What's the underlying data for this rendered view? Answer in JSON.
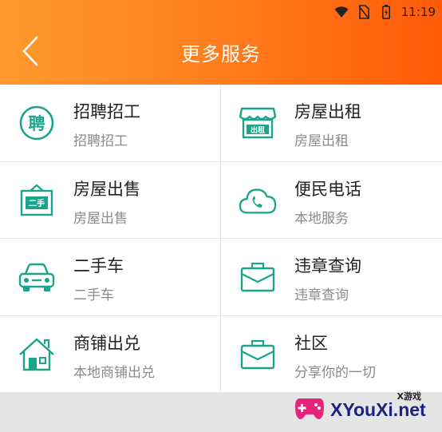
{
  "status_bar": {
    "time": "11:19"
  },
  "header": {
    "title": "更多服务"
  },
  "services": [
    {
      "title": "招聘招工",
      "subtitle": "招聘招工",
      "icon_text": "聘"
    },
    {
      "title": "房屋出租",
      "subtitle": "房屋出租",
      "icon_text": "出租"
    },
    {
      "title": "房屋出售",
      "subtitle": "房屋出售",
      "icon_text": "二手"
    },
    {
      "title": "便民电话",
      "subtitle": "本地服务"
    },
    {
      "title": "二手车",
      "subtitle": "二手车"
    },
    {
      "title": "违章查询",
      "subtitle": "违章查询"
    },
    {
      "title": "商铺出兑",
      "subtitle": "本地商铺出兑"
    },
    {
      "title": "社区",
      "subtitle": "分享你的一切"
    }
  ],
  "watermark": {
    "brand": "XYouXi.net",
    "tag": "X游戏"
  },
  "colors": {
    "accent": "#1aa58a",
    "header_start": "#ff9a2e",
    "header_end": "#ff5a08"
  }
}
